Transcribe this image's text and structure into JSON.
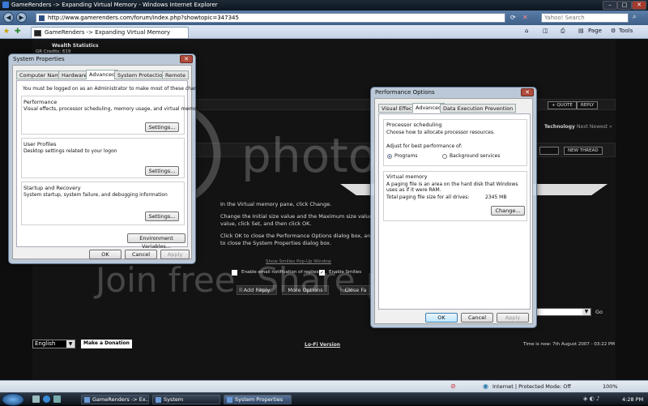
{
  "browser": {
    "window_title": "GameRenders -> Expanding Virtual Memory - Windows Internet Explorer",
    "url": "http://www.gamerenders.com/forum/index.php?showtopic=347345",
    "search_placeholder": "Yahoo! Search",
    "tab_title": "GameRenders -> Expanding Virtual Memory",
    "toolbar": {
      "page": "Page",
      "tools": "Tools"
    },
    "window_controls": {
      "minimize": "–",
      "maximize": "□",
      "close": "✕"
    }
  },
  "forum": {
    "user_stats": "Wealth Statistics",
    "credits": "GR Credits: 619",
    "quote": "+ QUOTE",
    "reply": "REPLY",
    "breadcrumb_category": "Technology",
    "breadcrumb_next": "Next Newest »",
    "new_thread": "NEW THREAD",
    "post_lines": [
      "In the Virtual memory pane, click Change.",
      "Change the Initial size value and the Maximum size value",
      "value, click Set, and then click OK.",
      "Click OK to close the Performance Options dialog box, an",
      "to close the System Properties dialog box."
    ],
    "show_smilies": "Show Smilies Pop-Up Window",
    "enable_email": "Enable email notification of replies",
    "enable_smilies": "Enable Smilies",
    "add_reply": "Add Reply",
    "more_options": "More Options",
    "close_fast": "Close Fa",
    "go": "Go",
    "language": "English",
    "donate": "Make a Donation",
    "lofi": "Lo-Fi Version",
    "time": "Time is now: 7th August 2007 - 03:22 PM"
  },
  "system_properties": {
    "title": "System Properties",
    "close": "✕",
    "tabs": [
      "Computer Name",
      "Hardware",
      "Advanced",
      "System Protection",
      "Remote"
    ],
    "selected_tab": "Advanced",
    "admin_note": "You must be logged on as an Administrator to make most of these changes.",
    "performance": {
      "label": "Performance",
      "desc": "Visual effects, processor scheduling, memory usage, and virtual memory",
      "button": "Settings..."
    },
    "user_profiles": {
      "label": "User Profiles",
      "desc": "Desktop settings related to your logon",
      "button": "Settings..."
    },
    "startup": {
      "label": "Startup and Recovery",
      "desc": "System startup, system failure, and debugging information",
      "button": "Settings..."
    },
    "env_button": "Environment Variables...",
    "ok": "OK",
    "cancel": "Cancel",
    "apply": "Apply"
  },
  "performance_options": {
    "title": "Performance Options",
    "close": "✕",
    "tabs": [
      "Visual Effects",
      "Advanced",
      "Data Execution Prevention"
    ],
    "selected_tab": "Advanced",
    "processor": {
      "label": "Processor scheduling",
      "desc": "Choose how to allocate processor resources.",
      "adjust": "Adjust for best performance of:",
      "opt_programs": "Programs",
      "opt_background": "Background services",
      "selected": "Programs"
    },
    "virtual_memory": {
      "label": "Virtual memory",
      "desc": "A paging file is an area on the hard disk that Windows uses as if it were RAM.",
      "total_label": "Total paging file size for all drives:",
      "total_value": "2345 MB",
      "change": "Change..."
    },
    "ok": "OK",
    "cancel": "Cancel",
    "apply": "Apply"
  },
  "statusbar": {
    "zone": "Internet | Protected Mode: Off",
    "zoom": "100%"
  },
  "taskbar": {
    "tasks": [
      "GameRenders -> Ex...",
      "System",
      "System Properties"
    ],
    "clock": "4:28 PM"
  },
  "watermark": {
    "line1": "photobucket",
    "line2": "Join free. Share privately."
  }
}
